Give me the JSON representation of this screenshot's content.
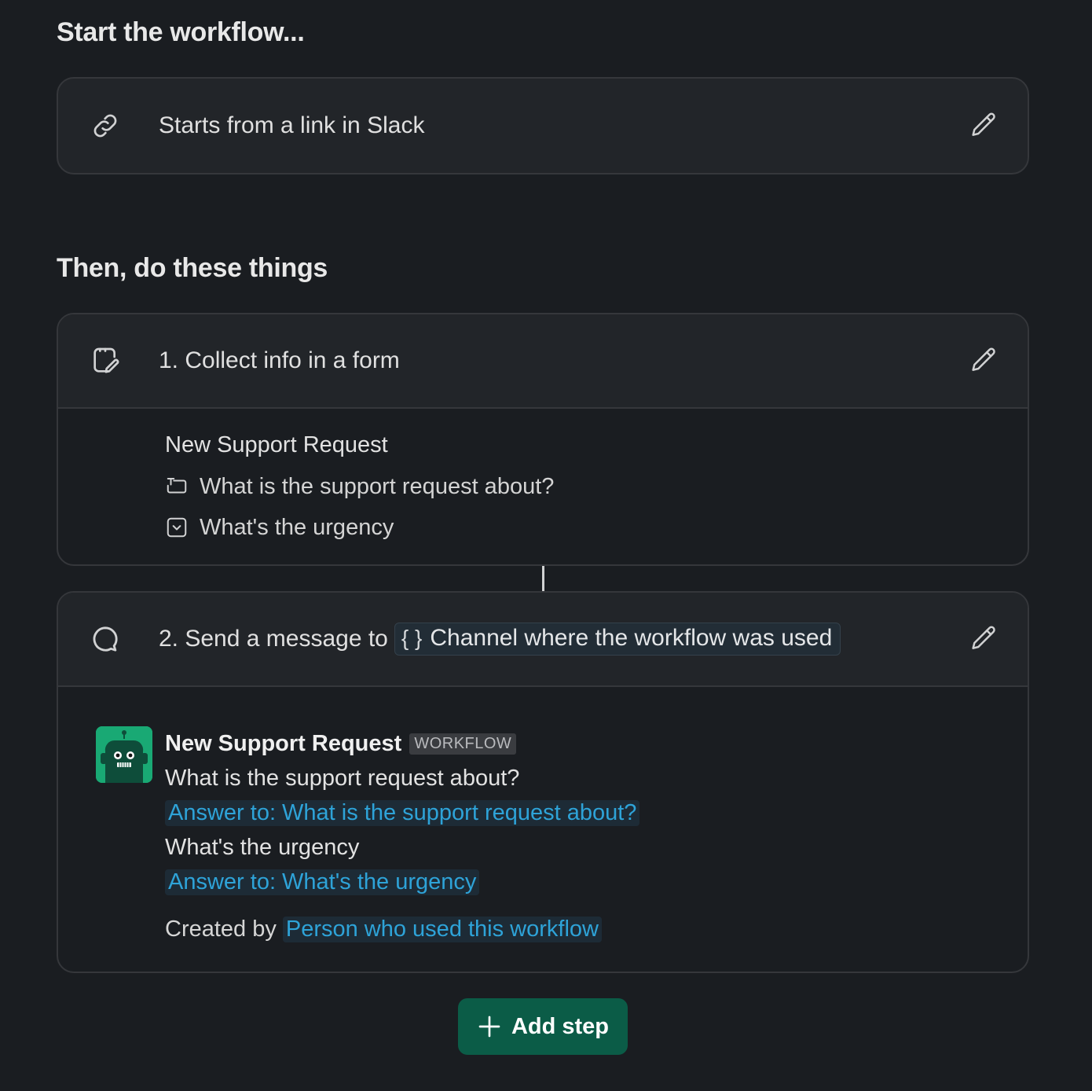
{
  "sections": {
    "start_title": "Start the workflow...",
    "then_title": "Then, do these things"
  },
  "trigger": {
    "icon": "link-icon",
    "label": "Starts from a link in Slack",
    "edit_icon": "pencil-icon"
  },
  "step1": {
    "icon": "form-icon",
    "label": "1. Collect info in a form",
    "edit_icon": "pencil-icon",
    "form_title": "New Support Request",
    "fields": [
      {
        "icon": "text-field-icon",
        "label": "What is the support request about?"
      },
      {
        "icon": "dropdown-field-icon",
        "label": "What's the urgency"
      }
    ]
  },
  "step2": {
    "icon": "message-bubble-icon",
    "label": "2. Send a message to",
    "variable_icon": "braces-icon",
    "variable_braces": "{ }",
    "variable_label": "Channel where the workflow was used",
    "edit_icon": "pencil-icon",
    "message": {
      "avatar_icon": "robot-avatar-icon",
      "sender": "New Support Request",
      "app_tag": "WORKFLOW",
      "question1": "What is the support request about?",
      "answer1": "Answer to: What is the support request about?",
      "question2": "What's the urgency",
      "answer2": "Answer to: What's the urgency",
      "created_by_label": "Created by",
      "created_by_value": "Person who used this workflow"
    }
  },
  "add_step": {
    "icon": "plus-icon",
    "label": "Add step"
  },
  "colors": {
    "background": "#1a1d21",
    "card_header": "#222529",
    "border": "#35373b",
    "accent_green": "#0b5c47",
    "link_blue": "#2ea3d8",
    "avatar_green": "#19a974"
  }
}
